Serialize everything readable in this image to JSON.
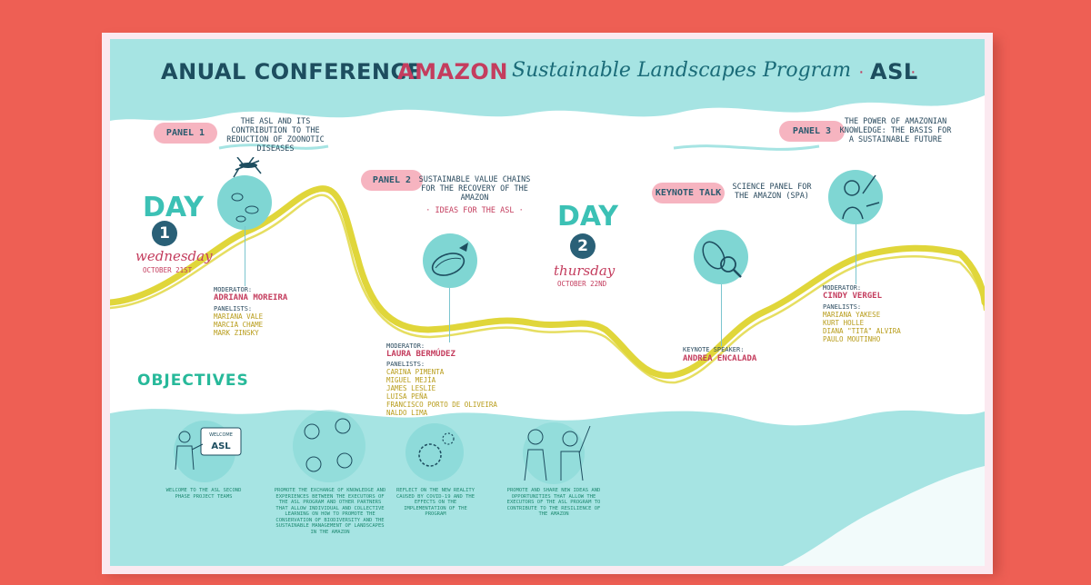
{
  "title": {
    "part1": "ANUAL CONFERENCE",
    "part2": "AMAZON",
    "part3": "Sustainable Landscapes Program",
    "part4": "ASL"
  },
  "colors": {
    "background": "#ee5f54",
    "teal": "#a6e4e3",
    "river": "#e0d63a",
    "dark": "#1d4d5f",
    "red": "#c43d5e",
    "pink": "#f6b4c0",
    "green": "#27b99a"
  },
  "days": [
    {
      "label": "DAY",
      "number": "1",
      "weekday": "wednesday",
      "date": "OCTOBER 21ST"
    },
    {
      "label": "DAY",
      "number": "2",
      "weekday": "thursday",
      "date": "OCTOBER 22ND"
    }
  ],
  "panels": [
    {
      "tag": "PANEL 1",
      "title": "THE ASL AND ITS CONTRIBUTION TO THE REDUCTION OF ZOONOTIC DISEASES",
      "icon": "mosquito-virus-icon",
      "moderator_label": "MODERATOR:",
      "moderator": "ADRIANA MOREIRA",
      "panelists_label": "PANELISTS:",
      "panelists": [
        "MARIANA VALE",
        "MARCIA CHAME",
        "MARK ZINSKY"
      ]
    },
    {
      "tag": "PANEL 2",
      "title": "SUSTAINABLE VALUE CHAINS FOR THE RECOVERY OF THE AMAZON",
      "subtitle": "· IDEAS FOR THE ASL ·",
      "icon": "cacao-pod-icon",
      "moderator_label": "MODERATOR:",
      "moderator": "LAURA BERMÚDEZ",
      "panelists_label": "PANELISTS:",
      "panelists": [
        "CARINA PIMENTA",
        "MIGUEL MEJÍA",
        "JAMES LESLIE",
        "LUISA PEÑA",
        "FRANCISCO PORTO DE OLIVEIRA",
        "NALDO LIMA"
      ]
    },
    {
      "tag": "KEYNOTE TALK",
      "title": "SCIENCE PANEL FOR THE AMAZON (SPA)",
      "icon": "leaf-magnifier-icon",
      "moderator_label": "KEYNOTE SPEAKER:",
      "moderator": "ANDREA ENCALADA"
    },
    {
      "tag": "PANEL 3",
      "title": "THE POWER OF AMAZONIAN KNOWLEDGE: THE BASIS FOR A SUSTAINABLE FUTURE",
      "icon": "indigenous-person-icon",
      "moderator_label": "MODERATOR:",
      "moderator": "CINDY VERGEL",
      "panelists_label": "PANELISTS:",
      "panelists": [
        "MARIANA YAKESE",
        "KURT HOLLE",
        "DIANA \"TITA\" ALVIRA",
        "PAULO MOUTINHO"
      ]
    }
  ],
  "objectives": {
    "heading": "OBJECTIVES",
    "items": [
      {
        "text": "WELCOME TO THE ASL SECOND PHASE PROJECT TEAMS",
        "icon": "presenter-icon",
        "board_top": "WELCOME",
        "board_main": "ASL"
      },
      {
        "text": "PROMOTE THE EXCHANGE OF KNOWLEDGE AND EXPERIENCES BETWEEN THE EXECUTORS OF THE ASL PROGRAM AND OTHER PARTNERS THAT ALLOW INDIVIDUAL AND COLLECTIVE LEARNING ON HOW TO PROMOTE THE CONSERVATION OF BIODIVERSITY AND THE SUSTAINABLE MANAGEMENT OF LANDSCAPES IN THE AMAZON",
        "icon": "people-exchange-icon"
      },
      {
        "text": "REFLECT ON THE NEW REALITY CAUSED BY COVID-19 AND THE EFFECTS ON THE IMPLEMENTATION OF THE PROGRAM",
        "icon": "virus-icon"
      },
      {
        "text": "PROMOTE AND SHARE NEW IDEAS AND OPPORTUNITIES THAT ALLOW THE EXECUTORS OF THE ASL PROGRAM TO CONTRIBUTE TO THE RESILIENCE OF THE AMAZON",
        "icon": "people-talking-icon"
      }
    ]
  }
}
